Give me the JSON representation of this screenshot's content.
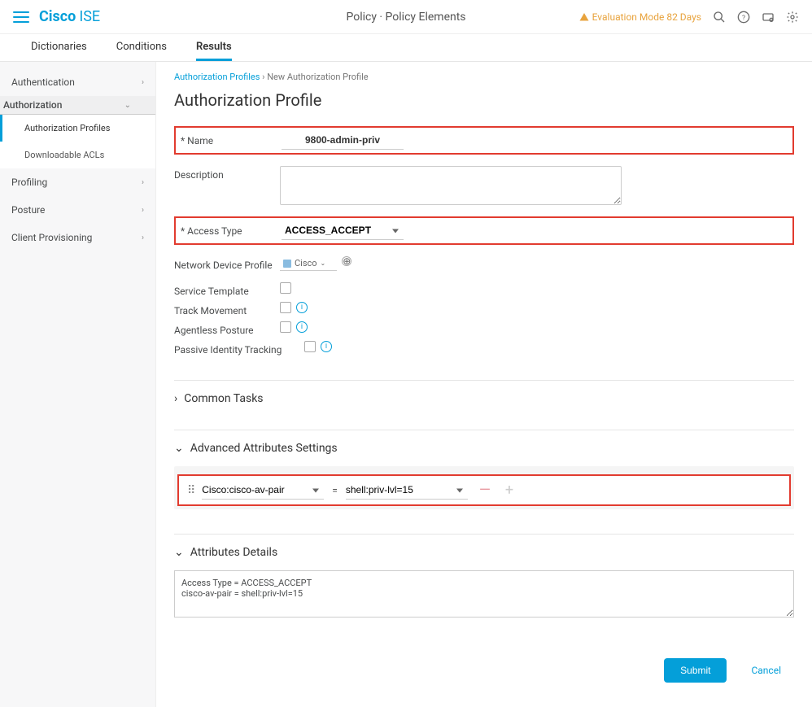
{
  "header": {
    "brand1": "Cisco",
    "brand2": "ISE",
    "title": "Policy · Policy Elements",
    "eval": "Evaluation Mode 82 Days"
  },
  "tabs": [
    "Dictionaries",
    "Conditions",
    "Results"
  ],
  "sidebar": {
    "items": [
      {
        "label": "Authentication",
        "exp": ">"
      },
      {
        "label": "Authorization",
        "exp": "v",
        "children": [
          "Authorization Profiles",
          "Downloadable ACLs"
        ]
      },
      {
        "label": "Profiling",
        "exp": ">"
      },
      {
        "label": "Posture",
        "exp": ">"
      },
      {
        "label": "Client Provisioning",
        "exp": ">"
      }
    ]
  },
  "breadcrumb": {
    "root": "Authorization Profiles",
    "sep": ">",
    "leaf": "New Authorization Profile"
  },
  "page": {
    "heading": "Authorization Profile",
    "name_label": "* Name",
    "name_value": "9800-admin-priv",
    "desc_label": "Description",
    "access_label": "* Access Type",
    "access_value": "ACCESS_ACCEPT",
    "ndp_label": "Network Device Profile",
    "ndp_value": "Cisco",
    "st_label": "Service Template",
    "tm_label": "Track Movement",
    "ap_label": "Agentless Posture",
    "pit_label": "Passive Identity Tracking",
    "common_tasks": "Common Tasks",
    "aas": "Advanced Attributes Settings",
    "aas_attr": "Cisco:cisco-av-pair",
    "aas_val": "shell:priv-lvl=15",
    "attr_details": "Attributes Details",
    "attr_text": "Access Type = ACCESS_ACCEPT\ncisco-av-pair = shell:priv-lvl=15",
    "submit": "Submit",
    "cancel": "Cancel"
  }
}
